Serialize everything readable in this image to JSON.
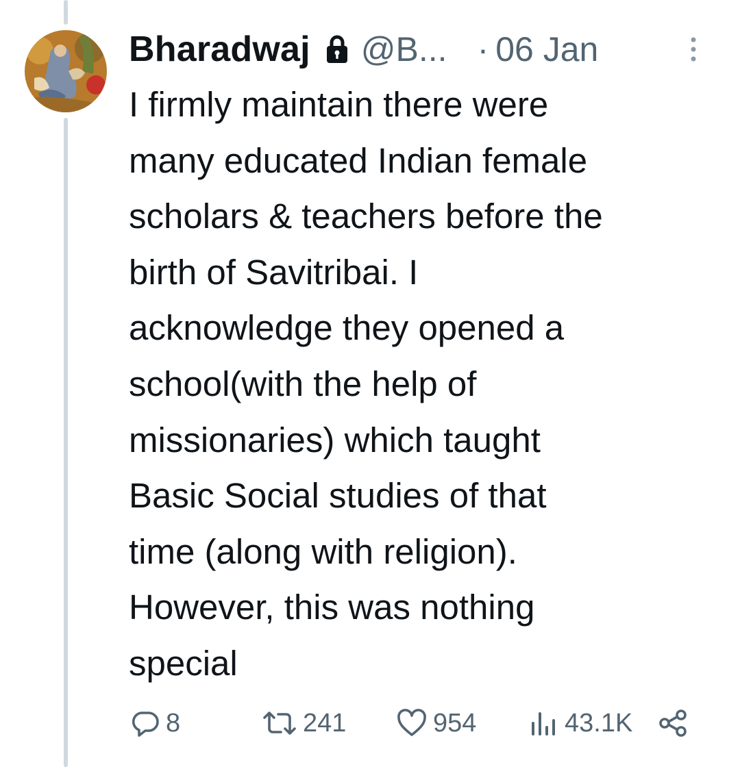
{
  "author": {
    "name": "Bharadwaj",
    "handle": "@B...",
    "date": "06 Jan",
    "separator": "·",
    "protected": true,
    "icons": {
      "lock": "lock-icon",
      "more": "more-vertical-icon"
    }
  },
  "tweet": {
    "text": "I firmly maintain there were\nmany educated Indian female\nscholars & teachers before the\nbirth of Savitribai. I\nacknowledge they opened a\nschool(with the help of\nmissionaries) which taught\nBasic Social studies of that\ntime (along with religion).\nHowever, this was nothing\nspecial"
  },
  "actions": {
    "reply": {
      "icon": "reply-icon",
      "count": "8"
    },
    "retweet": {
      "icon": "retweet-icon",
      "count": "241"
    },
    "like": {
      "icon": "heart-icon",
      "count": "954"
    },
    "views": {
      "icon": "views-chart-icon",
      "count": "43.1K"
    },
    "share": {
      "icon": "share-icon"
    }
  },
  "colors": {
    "text": "#0f1419",
    "secondary": "#536471",
    "thread_line": "#cfd9de",
    "background": "#ffffff"
  }
}
